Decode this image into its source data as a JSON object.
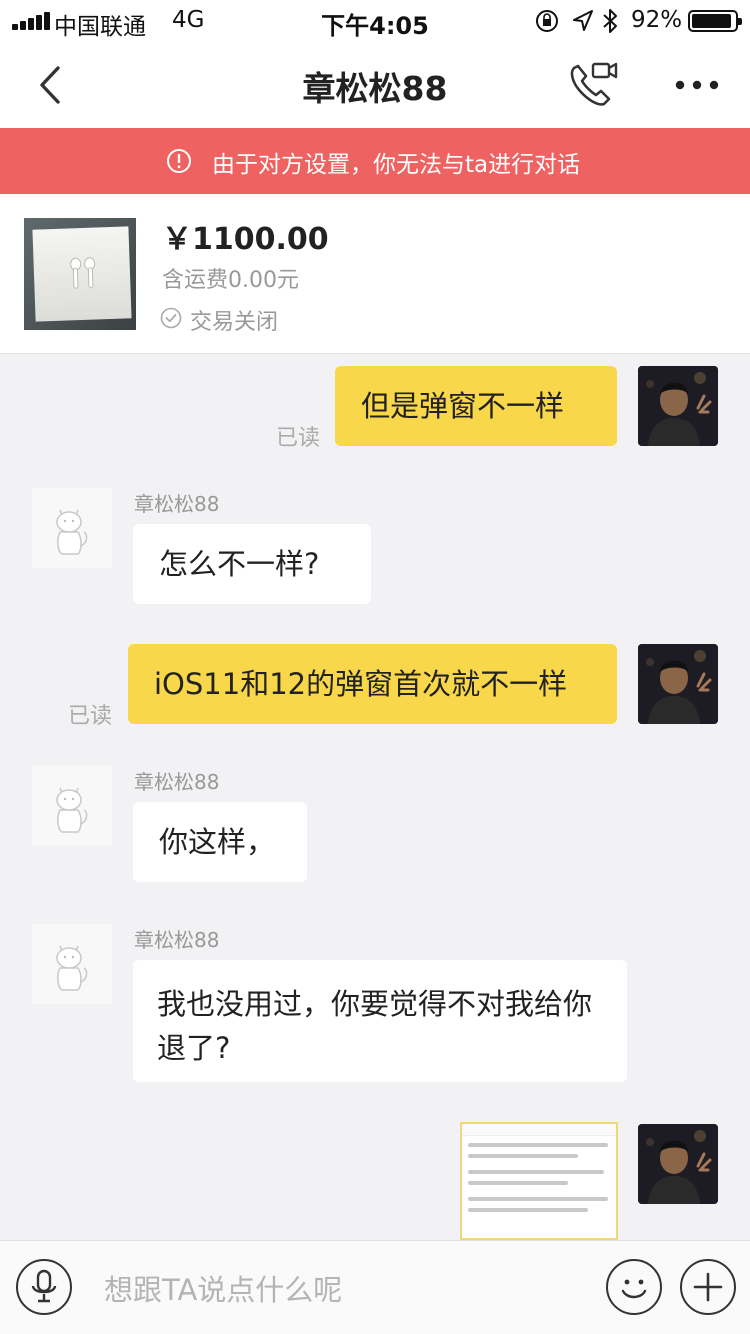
{
  "status_bar": {
    "carrier": "中国联通",
    "network": "4G",
    "time": "下午4:05",
    "battery_percent": "92%",
    "battery_level": 0.92
  },
  "nav": {
    "title": "章松松88",
    "icons": {
      "back": "chevron-left-icon",
      "call": "video-call-icon",
      "more": "more-dots-icon"
    }
  },
  "banner": {
    "icon": "info-icon",
    "text": "由于对方设置，你无法与ta进行对话",
    "color": "#ee6262"
  },
  "product": {
    "price": "￥1100.00",
    "shipping": "含运费0.00元",
    "status": "交易关闭"
  },
  "messages": [
    {
      "from": "me",
      "text": "但是弹窗不一样",
      "read_label": "已读"
    },
    {
      "from": "other",
      "sender": "章松松88",
      "text": "怎么不一样?"
    },
    {
      "from": "me",
      "text": "iOS11和12的弹窗首次就不一样",
      "read_label": "已读"
    },
    {
      "from": "other",
      "sender": "章松松88",
      "text": "你这样，"
    },
    {
      "from": "other",
      "sender": "章松松88",
      "text": "我也没用过，你要觉得不对我给你退了?"
    },
    {
      "from": "me",
      "type": "image"
    }
  ],
  "input": {
    "placeholder": "想跟TA说点什么呢",
    "icons": {
      "voice": "microphone-icon",
      "emoji": "emoji-icon",
      "plus": "plus-icon"
    }
  },
  "colors": {
    "my_bubble": "#f8d74a",
    "other_bubble": "#ffffff",
    "background": "#f2f2f4"
  }
}
